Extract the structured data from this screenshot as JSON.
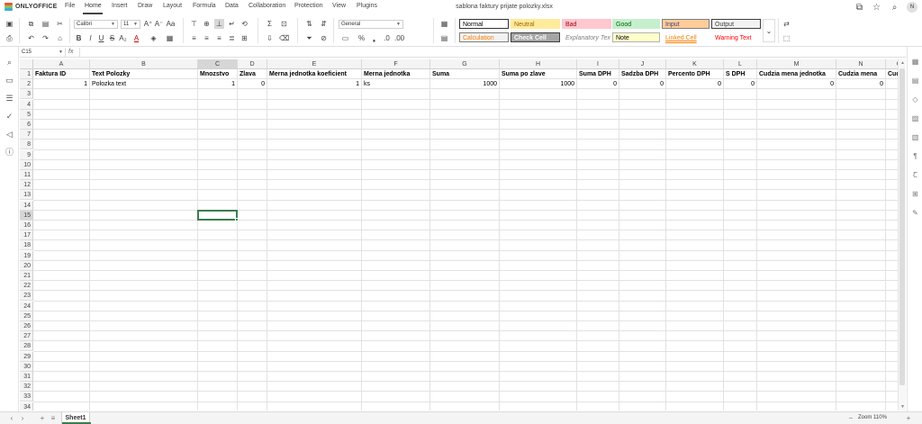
{
  "app": {
    "name": "ONLYOFFICE",
    "document_title": "sablona faktury prijate polozky.xlsx"
  },
  "menu": {
    "tabs": [
      "File",
      "Home",
      "Insert",
      "Draw",
      "Layout",
      "Formula",
      "Data",
      "Collaboration",
      "Protection",
      "View",
      "Plugins"
    ],
    "active": "Home"
  },
  "user": {
    "initial": "N"
  },
  "ribbon": {
    "font_name": "Calibri",
    "font_size": "11",
    "number_format": "General",
    "cell_styles": [
      {
        "label": "Normal",
        "color": "#000000",
        "bg": "#ffffff",
        "border": "#333333"
      },
      {
        "label": "Neutral",
        "color": "#9c6500",
        "bg": "#ffeb9c",
        "border": "#ffeb9c"
      },
      {
        "label": "Bad",
        "color": "#9c0006",
        "bg": "#ffc7ce",
        "border": "#ffc7ce"
      },
      {
        "label": "Good",
        "color": "#006100",
        "bg": "#c6efce",
        "border": "#c6efce"
      },
      {
        "label": "Input",
        "color": "#3f3f76",
        "bg": "#ffcc99",
        "border": "#7f7f7f"
      },
      {
        "label": "Output",
        "color": "#3f3f3f",
        "bg": "#f2f2f2",
        "border": "#3f3f3f"
      },
      {
        "label": "Calculation",
        "color": "#fa7d00",
        "bg": "#f2f2f2",
        "border": "#7f7f7f"
      },
      {
        "label": "Check Cell",
        "color": "#ffffff",
        "bg": "#a5a5a5",
        "border": "#3f3f3f"
      },
      {
        "label": "Explanatory Tex",
        "color": "#7f7f7f",
        "bg": "#ffffff",
        "border": "#ffffff"
      },
      {
        "label": "Note",
        "color": "#000000",
        "bg": "#ffffcc",
        "border": "#b2b2b2"
      },
      {
        "label": "Linked Cell",
        "color": "#fa7d00",
        "bg": "#ffffff",
        "border": "#ffffff"
      },
      {
        "label": "Warning Text",
        "color": "#ff0000",
        "bg": "#ffffff",
        "border": "#ffffff"
      }
    ]
  },
  "formula_bar": {
    "cell_ref": "C15",
    "fx": "fx",
    "formula": ""
  },
  "columns": [
    "A",
    "B",
    "C",
    "D",
    "E",
    "F",
    "G",
    "H",
    "I",
    "J",
    "K",
    "L",
    "M",
    "N",
    "O"
  ],
  "selected_column": "C",
  "selected_row": "15",
  "row_numbers": [
    "1",
    "2",
    "3",
    "4",
    "5",
    "6",
    "7",
    "8",
    "9",
    "10",
    "11",
    "12",
    "13",
    "14",
    "15",
    "16",
    "17",
    "18",
    "19",
    "20",
    "21",
    "22",
    "23",
    "24",
    "25",
    "26",
    "27",
    "28",
    "29",
    "30",
    "31",
    "32",
    "33",
    "34"
  ],
  "rows": [
    [
      "Faktura ID",
      "Text Polozky",
      "Mnozstvo",
      "Zlava",
      "Merna jednotka koeficient",
      "Merna jednotka",
      "Suma",
      "Suma po zlave",
      "Suma DPH",
      "Sadzba DPH",
      "Percento DPH",
      "S DPH",
      "Cudzia mena jednotka",
      "Cudzia mena",
      "Cud"
    ],
    [
      "1",
      "Polozka text",
      "1",
      "0",
      "1",
      "ks",
      "1000",
      "1000",
      "0",
      "0",
      "0",
      "0",
      "0",
      "0",
      ""
    ]
  ],
  "sheets": [
    "Sheet1"
  ],
  "zoom": "Zoom 110%",
  "colors": {
    "selection": "#3a7d4f",
    "header_bg": "#f4f4f4",
    "header_selected_bg": "#d6d6d6"
  }
}
